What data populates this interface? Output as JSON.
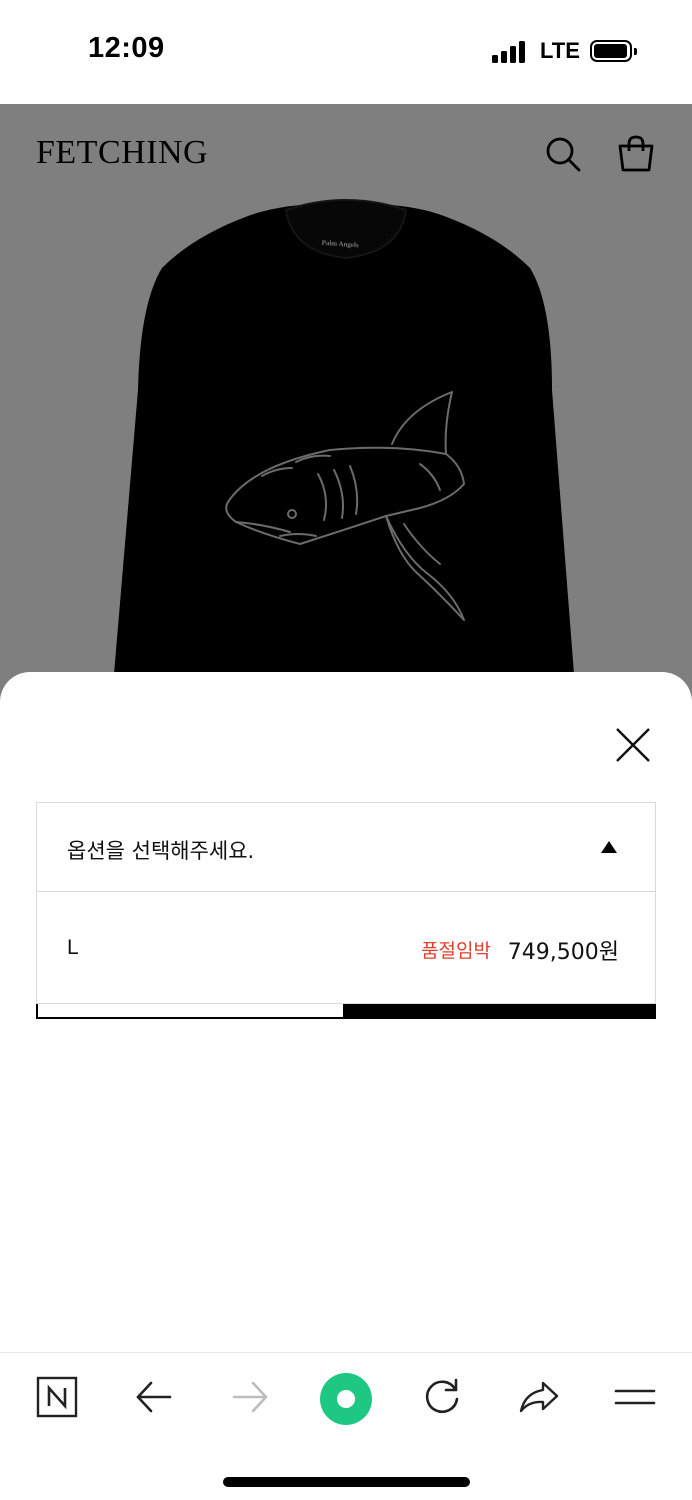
{
  "status_bar": {
    "time": "12:09",
    "network": "LTE"
  },
  "header": {
    "logo": "FETCHING",
    "icons": [
      "search-icon",
      "shopping-bag-icon"
    ]
  },
  "product_print": {
    "collar_label": "Palm Angels"
  },
  "option_sheet": {
    "select_placeholder": "옵션을 선택해주세요.",
    "options": [
      {
        "size": "L",
        "status": "품절임박",
        "price": "749,500원"
      }
    ]
  },
  "browser_toolbar": {
    "items": [
      "naver-home-icon",
      "back-arrow-icon",
      "forward-arrow-icon",
      "green-dot-icon",
      "reload-icon",
      "share-icon",
      "menu-icon"
    ]
  },
  "colors": {
    "overlay": "#7f7f7f",
    "status_red": "#e0402f",
    "naver_green": "#1ec882"
  }
}
